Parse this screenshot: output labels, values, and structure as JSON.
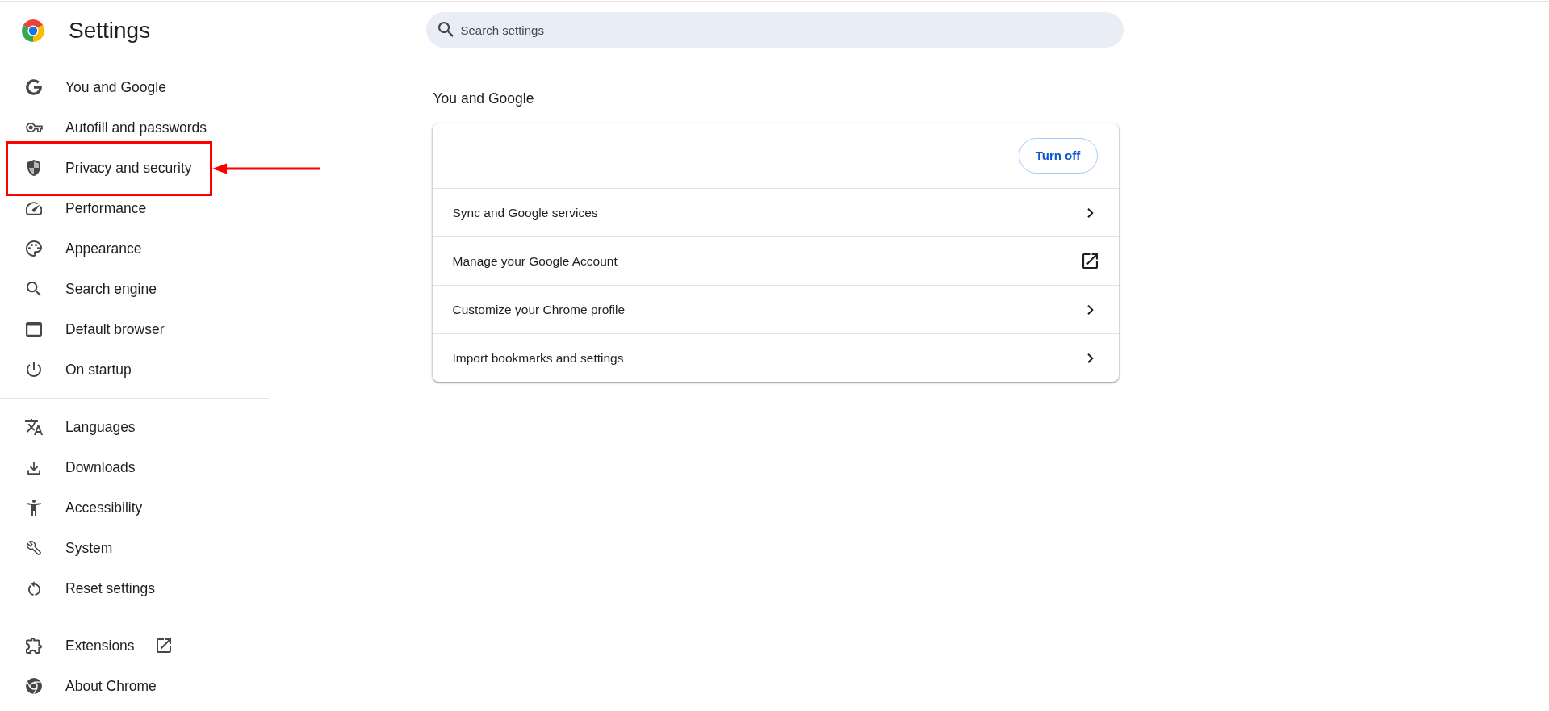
{
  "header": {
    "title": "Settings"
  },
  "search": {
    "placeholder": "Search settings"
  },
  "sidebar": {
    "groups": [
      {
        "items": [
          {
            "label": "You and Google",
            "kind": "page",
            "highlighted": false
          },
          {
            "label": "Autofill and passwords",
            "kind": "page",
            "highlighted": false
          },
          {
            "label": "Privacy and security",
            "kind": "page",
            "highlighted": true
          },
          {
            "label": "Performance",
            "kind": "page",
            "highlighted": false
          },
          {
            "label": "Appearance",
            "kind": "page",
            "highlighted": false
          },
          {
            "label": "Search engine",
            "kind": "page",
            "highlighted": false
          },
          {
            "label": "Default browser",
            "kind": "page",
            "highlighted": false
          },
          {
            "label": "On startup",
            "kind": "page",
            "highlighted": false
          }
        ]
      },
      {
        "items": [
          {
            "label": "Languages",
            "kind": "page",
            "highlighted": false
          },
          {
            "label": "Downloads",
            "kind": "page",
            "highlighted": false
          },
          {
            "label": "Accessibility",
            "kind": "page",
            "highlighted": false
          },
          {
            "label": "System",
            "kind": "page",
            "highlighted": false
          },
          {
            "label": "Reset settings",
            "kind": "page",
            "highlighted": false
          }
        ]
      },
      {
        "items": [
          {
            "label": "Extensions",
            "kind": "external",
            "highlighted": false
          },
          {
            "label": "About Chrome",
            "kind": "page",
            "highlighted": false
          }
        ]
      }
    ]
  },
  "section": {
    "title": "You and Google",
    "card": {
      "button": "Turn off",
      "rows": [
        {
          "label": "Sync and Google services",
          "kind": "subpage"
        },
        {
          "label": "Manage your Google Account",
          "kind": "external"
        },
        {
          "label": "Customize your Chrome profile",
          "kind": "subpage"
        },
        {
          "label": "Import bookmarks and settings",
          "kind": "subpage"
        }
      ]
    }
  }
}
